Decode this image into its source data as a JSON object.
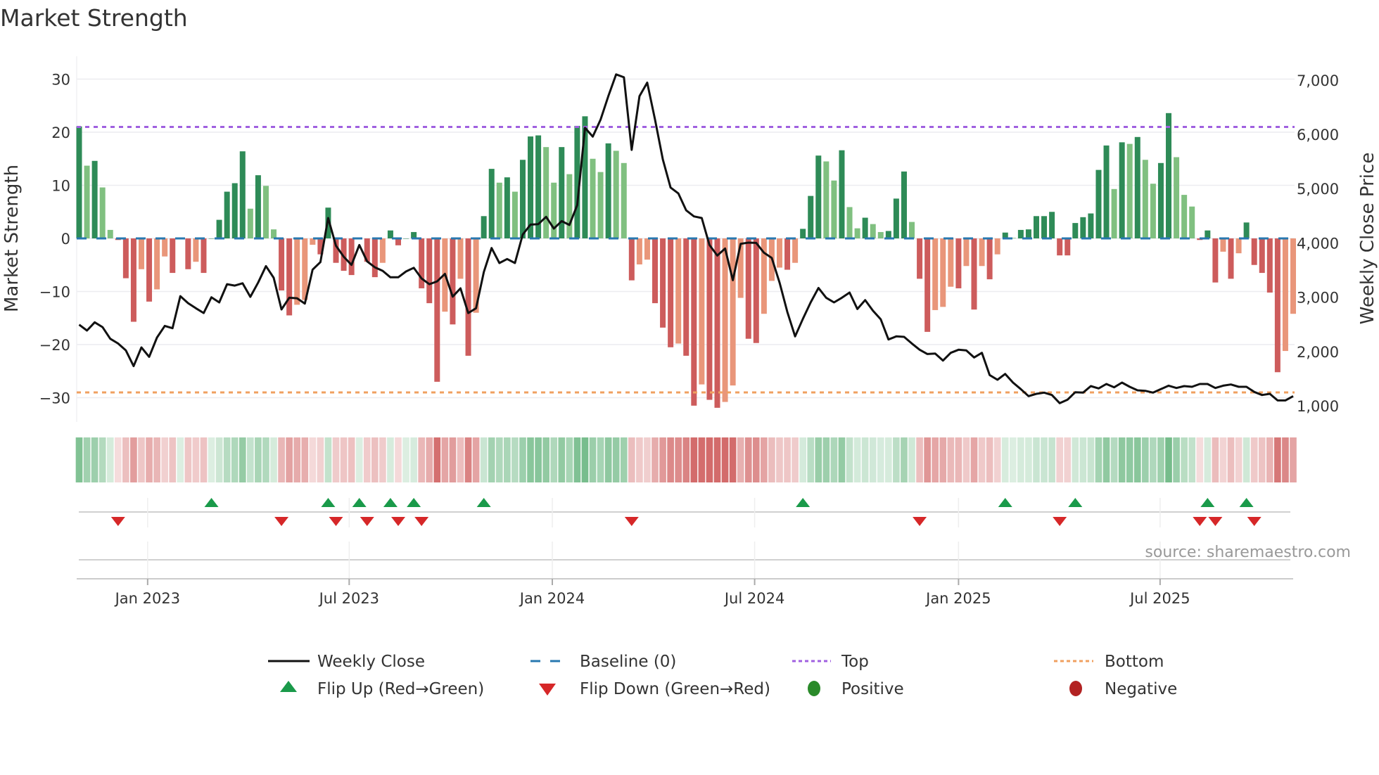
{
  "title": "Market Strength",
  "source": "source: sharemaestro.com",
  "legend": {
    "weekly_close": "Weekly Close",
    "baseline": "Baseline (0)",
    "top": "Top",
    "bottom": "Bottom",
    "flip_up": "Flip Up (Red→Green)",
    "flip_down": "Flip Down (Green→Red)",
    "positive": "Positive",
    "negative": "Negative"
  },
  "colors": {
    "pos_up": "#2e8b57",
    "pos_down": "#80c080",
    "neg_down": "#cd5c5c",
    "neg_up": "#e9967a",
    "price": "#111111",
    "baseline": "#2878b0",
    "top": "#a060e0",
    "bottom": "#f0a060",
    "flip_up": "#1a9a4a",
    "flip_down": "#d62728",
    "positive": "#2a8a2a",
    "negative": "#b22222"
  },
  "chart_data": {
    "type": "bar+line",
    "title": "Market Strength",
    "ylabel": "Market Strength",
    "y2label": "Weekly Close Price",
    "ylim": [
      -32,
      32
    ],
    "y2lim": [
      700,
      7300
    ],
    "yticks": [
      "30",
      "20",
      "10",
      "0",
      "−10",
      "−20",
      "−30"
    ],
    "ytick_values": [
      30,
      20,
      10,
      0,
      -10,
      -20,
      -30
    ],
    "y2ticks": [
      "7,000",
      "6,000",
      "5,000",
      "4,000",
      "3,000",
      "2,000",
      "1,000"
    ],
    "y2tick_values": [
      7000,
      6000,
      5000,
      4000,
      3000,
      2000,
      1000
    ],
    "xticks": [
      "Jan 2023",
      "Jul 2023",
      "Jan 2024",
      "Jul 2024",
      "Jan 2025",
      "Jul 2025"
    ],
    "xtick_week_index": [
      8.8,
      34.7,
      60.8,
      86.8,
      113,
      138.9
    ],
    "top_level": 21,
    "bottom_level": -29,
    "baseline": 0,
    "start_week": "2022-11-04",
    "strength": [
      21.1,
      13.7,
      14.6,
      9.6,
      1.6,
      -0.3,
      -7.5,
      -15.7,
      -5.8,
      -11.9,
      -9.6,
      -3.4,
      -6.5,
      0,
      -5.8,
      -4.4,
      -6.5,
      0,
      3.5,
      8.8,
      10.4,
      16.4,
      5.6,
      11.9,
      9.9,
      1.7,
      -9.8,
      -14.5,
      -12.5,
      -11.6,
      -1.2,
      -3,
      5.8,
      -4.6,
      -6.1,
      -6.9,
      0,
      -4.4,
      -7.3,
      -4.6,
      1.5,
      -1.3,
      0,
      1.2,
      -9.4,
      -12.2,
      -27,
      -13.8,
      -16.2,
      -7.6,
      -22.1,
      -14,
      4.2,
      13.1,
      10.5,
      11.5,
      8.8,
      14.8,
      19.2,
      19.4,
      17.2,
      10.5,
      17.2,
      12.1,
      21.2,
      23,
      15,
      12.5,
      17.9,
      16.5,
      14.2,
      -7.9,
      -4.9,
      -4,
      -12.2,
      -16.8,
      -20.5,
      -19.8,
      -22.1,
      -31.5,
      -27.5,
      -30.4,
      -31.9,
      -30.8,
      -27.7,
      -11.2,
      -18.9,
      -19.7,
      -14.2,
      -8,
      -5.5,
      -5.9,
      -4.6,
      1.8,
      8,
      15.6,
      14.5,
      10.9,
      16.6,
      5.9,
      1.9,
      3.9,
      2.7,
      1.2,
      1.4,
      7.5,
      12.6,
      3.1,
      -7.6,
      -17.6,
      -13.5,
      -12.9,
      -9.1,
      -9.4,
      -5.2,
      -13.4,
      -5.2,
      -7.7,
      -3,
      1.1,
      0.1,
      1.6,
      1.7,
      4.2,
      4.2,
      5,
      -3.2,
      -3.2,
      2.9,
      4,
      4.7,
      12.9,
      17.5,
      9.3,
      18.1,
      17.8,
      19.1,
      14.8,
      10.3,
      14.2,
      23.6,
      15.3,
      8.2,
      6,
      -0.3,
      1.5,
      -8.3,
      -2.5,
      -7.6,
      -2.8,
      3,
      -5,
      -6.5,
      -10.2,
      -25.2,
      -21.2,
      -14.2
    ],
    "weekly_close": [
      2493,
      2386,
      2537,
      2450,
      2234,
      2148,
      2019,
      1730,
      2075,
      1902,
      2256,
      2472,
      2429,
      3020,
      2890,
      2796,
      2709,
      2999,
      2904,
      3240,
      3214,
      3257,
      3007,
      3270,
      3573,
      3357,
      2774,
      2990,
      2981,
      2882,
      3508,
      3646,
      4458,
      3948,
      3745,
      3594,
      3961,
      3659,
      3551,
      3486,
      3366,
      3366,
      3474,
      3542,
      3344,
      3240,
      3292,
      3430,
      3011,
      3163,
      2709,
      2796,
      3465,
      3905,
      3629,
      3703,
      3629,
      4156,
      4337,
      4346,
      4480,
      4264,
      4402,
      4330,
      4695,
      6119,
      5957,
      6271,
      6702,
      7104,
      7051,
      5714,
      6702,
      6952,
      6271,
      5537,
      5019,
      4911,
      4600,
      4488,
      4458,
      3961,
      3767,
      3897,
      3314,
      3983,
      4005,
      4000,
      3819,
      3724,
      3270,
      2731,
      2278,
      2602,
      2904,
      3171,
      2990,
      2904,
      2990,
      3085,
      2783,
      2947,
      2752,
      2593,
      2222,
      2278,
      2270,
      2148,
      2032,
      1954,
      1963,
      1833,
      1975,
      2032,
      2019,
      1890,
      1975,
      1566,
      1479,
      1587,
      1427,
      1307,
      1177,
      1220,
      1242,
      1198,
      1048,
      1112,
      1250,
      1242,
      1363,
      1320,
      1401,
      1341,
      1427,
      1350,
      1285,
      1276,
      1242,
      1307,
      1371,
      1328,
      1363,
      1350,
      1401,
      1401,
      1328,
      1371,
      1393,
      1350,
      1350,
      1255,
      1198,
      1220,
      1099,
      1099,
      1177
    ],
    "flip_up_weeks": [
      17,
      32,
      36,
      40,
      43,
      52,
      93,
      119,
      128,
      145,
      150
    ],
    "flip_down_weeks": [
      5,
      26,
      33,
      37,
      41,
      44,
      71,
      108,
      126,
      144,
      146,
      151
    ]
  }
}
